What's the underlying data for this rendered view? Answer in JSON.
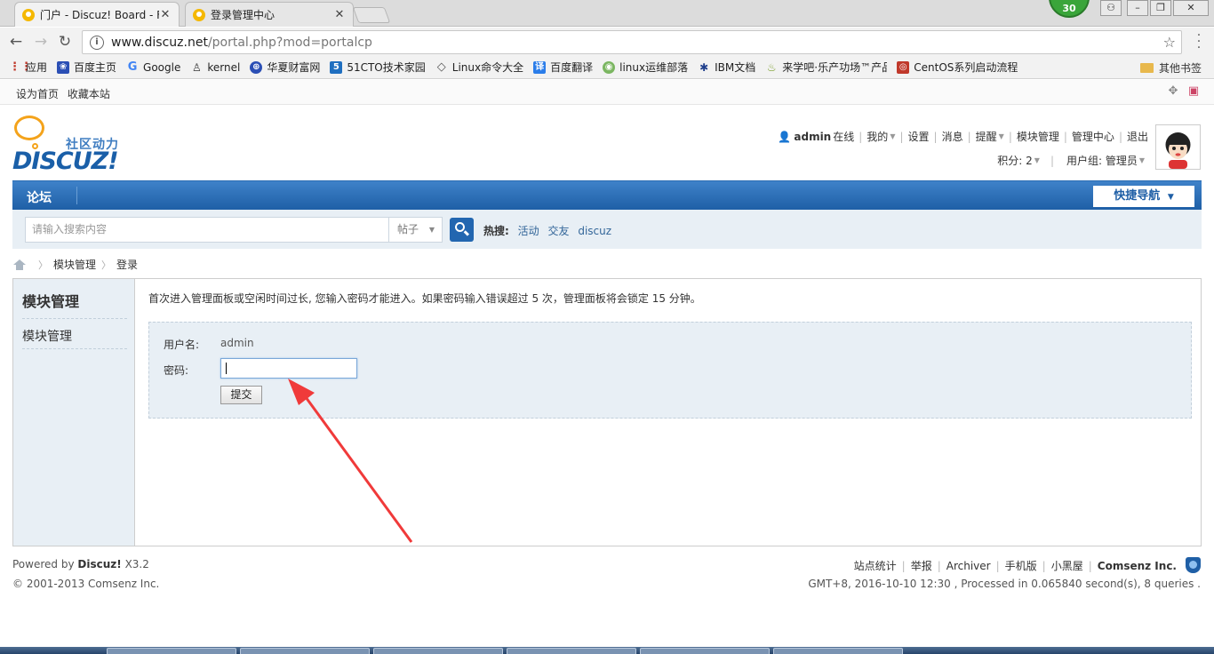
{
  "browser": {
    "tabs": [
      {
        "title": "门户 - Discuz! Board - F"
      },
      {
        "title": "登录管理中心"
      }
    ],
    "badge": "30",
    "url_host": "www.discuz.net",
    "url_path": "/portal.php?mod=portalcp",
    "bookmarks": [
      {
        "label": "应用",
        "icon_color": "#c0392b"
      },
      {
        "label": "百度主页",
        "icon_color": "#2b4fb5"
      },
      {
        "label": "Google",
        "icon_color": "#4285f4"
      },
      {
        "label": "kernel",
        "icon_color": "#333333"
      },
      {
        "label": "华夏财富网",
        "icon_color": "#2b4fb5"
      },
      {
        "label": "51CTO技术家园",
        "icon_color": "#1f6fc0"
      },
      {
        "label": "Linux命令大全",
        "icon_color": "#555555"
      },
      {
        "label": "百度翻译",
        "icon_color": "#2b7de9"
      },
      {
        "label": "linux运维部落",
        "icon_color": "#7bb661"
      },
      {
        "label": "IBM文档",
        "icon_color": "#1f3f8c"
      },
      {
        "label": "来学吧·乐产功场™产品",
        "icon_color": "#7a9f2a"
      },
      {
        "label": "CentOS系列启动流程",
        "icon_color": "#c0392b"
      }
    ],
    "bookmark_folder": "其他书签"
  },
  "topnav": {
    "set_home": "设为首页",
    "favorite": "收藏本站"
  },
  "logo": {
    "slogan": "社区动力",
    "word": "DISCUZ!"
  },
  "user": {
    "name": "admin",
    "status": "在线",
    "links": [
      "我的",
      "设置",
      "消息",
      "提醒",
      "模块管理",
      "管理中心",
      "退出"
    ],
    "points": "积分: 2",
    "group": "用户组: 管理员"
  },
  "mainnav": {
    "forum": "论坛",
    "quick_nav": "快捷导航"
  },
  "search": {
    "placeholder": "请输入搜索内容",
    "type": "帖子",
    "hot_label": "热搜:",
    "hot_terms": [
      "活动",
      "交友",
      "discuz"
    ]
  },
  "breadcrumb": {
    "items": [
      "模块管理",
      "登录"
    ]
  },
  "sidebar": {
    "title": "模块管理",
    "item": "模块管理"
  },
  "main": {
    "notice": "首次进入管理面板或空闲时间过长, 您输入密码才能进入。如果密码输入错误超过 5 次，管理面板将会锁定 15 分钟。",
    "username_label": "用户名:",
    "username_value": "admin",
    "password_label": "密码:",
    "password_value": "",
    "submit": "提交"
  },
  "footer": {
    "powered_prefix": "Powered by",
    "powered_brand": "Discuz!",
    "powered_version": "X3.2",
    "copyright": "© 2001-2013 Comsenz Inc.",
    "links": [
      "站点统计",
      "举报",
      "Archiver",
      "手机版",
      "小黑屋"
    ],
    "company": "Comsenz Inc.",
    "processed": "GMT+8, 2016-10-10 12:30 , Processed in 0.065840 second(s), 8 queries ."
  }
}
